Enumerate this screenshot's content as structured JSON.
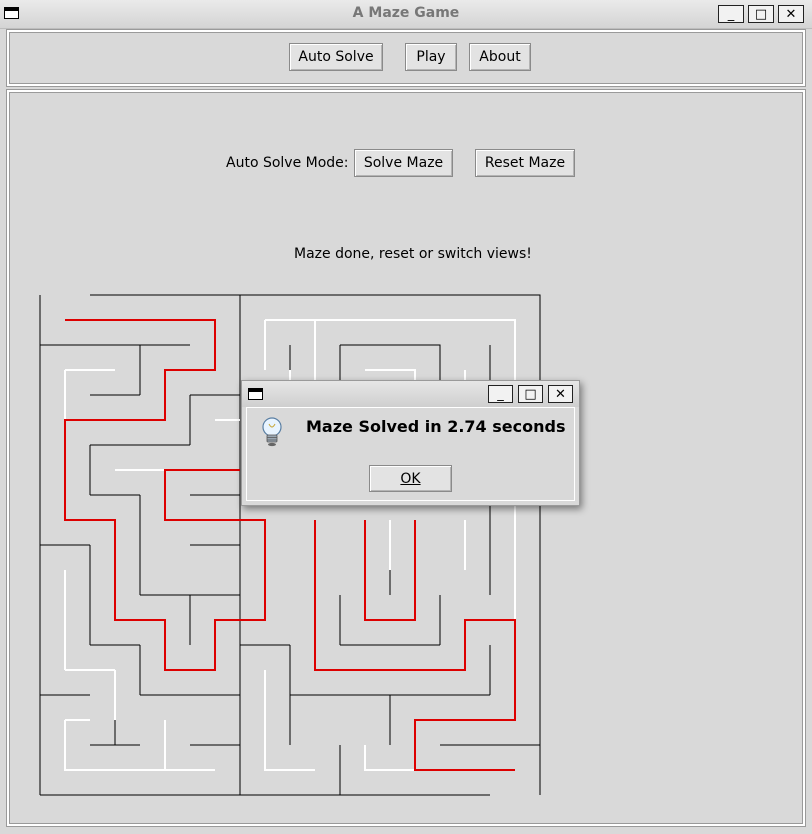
{
  "window": {
    "title": "A Maze Game",
    "controls": {
      "minimize": "_",
      "maximize": "□",
      "close": "✕"
    }
  },
  "toolbar": {
    "auto_solve": "Auto Solve",
    "play": "Play",
    "about": "About"
  },
  "mode_bar": {
    "label": "Auto Solve Mode:",
    "solve": "Solve Maze",
    "reset": "Reset Maze"
  },
  "status": {
    "text": "Maze done, reset or switch views!"
  },
  "colors": {
    "wall": "#000000",
    "visited": "#ffffff",
    "solution": "#dd0000"
  },
  "dialog": {
    "message": "Maze Solved in 2.74 seconds",
    "ok": "OK",
    "icon": "lightbulb-icon"
  }
}
